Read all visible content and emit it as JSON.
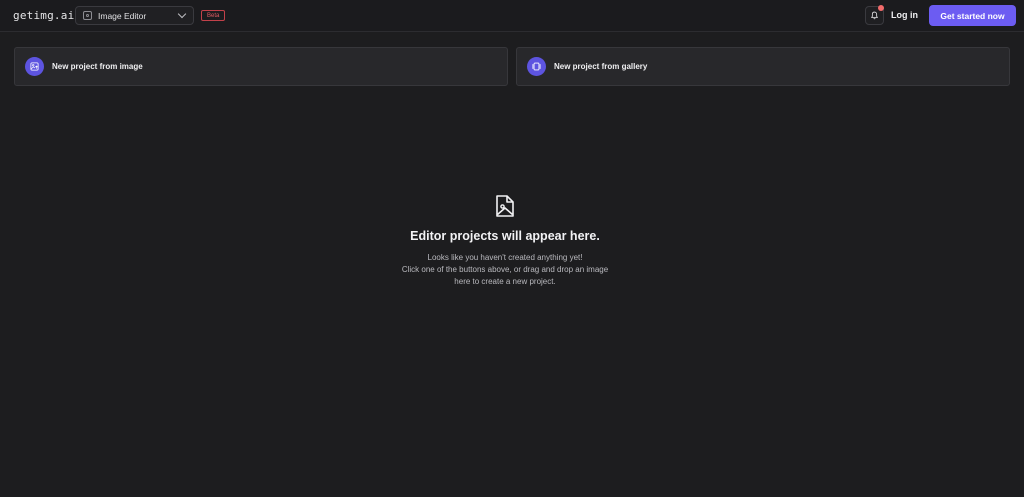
{
  "header": {
    "logo": "getimg.ai",
    "tool_select": {
      "label": "Image Editor",
      "icon": "image-editor-icon"
    },
    "badge": "Beta",
    "notifications": {
      "icon": "bell-icon",
      "has_unread": true
    },
    "login_label": "Log in",
    "cta_label": "Get started now"
  },
  "cards": [
    {
      "label": "New project from image",
      "icon": "image-upload-icon"
    },
    {
      "label": "New project from gallery",
      "icon": "gallery-icon"
    }
  ],
  "empty_state": {
    "icon": "file-image-icon",
    "title": "Editor projects will appear here.",
    "lines": [
      "Looks like you haven't created anything yet!",
      "Click one of the buttons above, or drag and drop an image",
      "here to create a new project."
    ]
  },
  "colors": {
    "background": "#1d1d1f",
    "accent": "#6c5cf2",
    "icon_circle": "#5d54e0",
    "badge": "#e05b63"
  }
}
